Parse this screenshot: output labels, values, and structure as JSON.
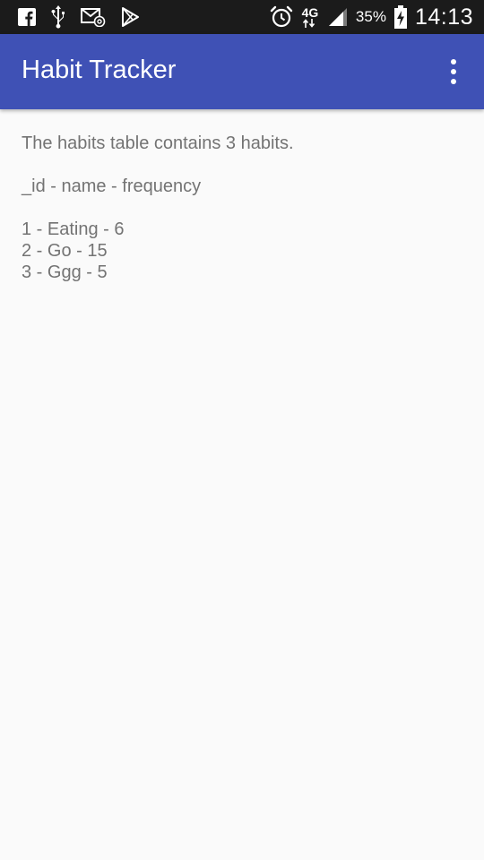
{
  "status_bar": {
    "left_icons": [
      "facebook-icon",
      "usb-icon",
      "email-icon",
      "play-store-icon"
    ],
    "network": "4G",
    "battery_percent": "35%",
    "time": "14:13"
  },
  "app_bar": {
    "title": "Habit Tracker",
    "color": "#3f51b5"
  },
  "content": {
    "summary": "The habits table contains 3 habits.",
    "header": "_id - name - frequency",
    "rows": [
      "1 - Eating - 6",
      "2 - Go - 15",
      "3 - Ggg - 5"
    ]
  }
}
